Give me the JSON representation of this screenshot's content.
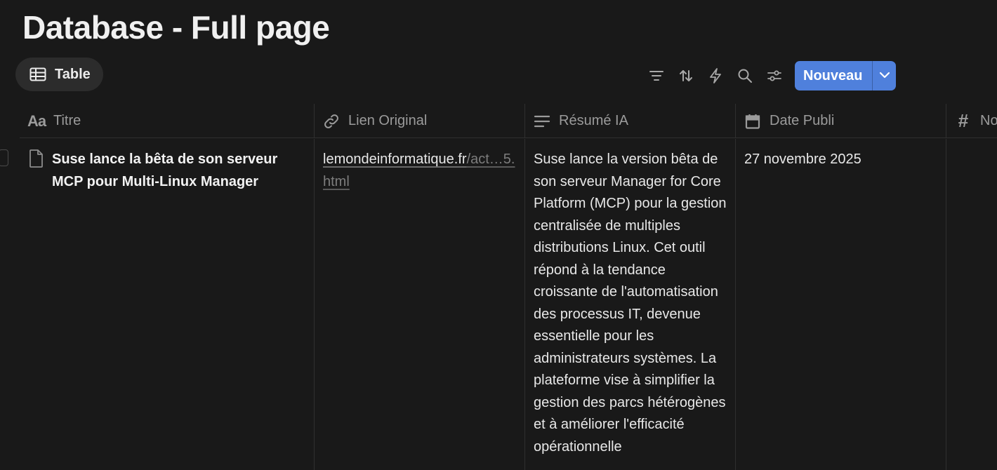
{
  "page": {
    "title": "Database - Full page"
  },
  "views": {
    "active_label": "Table"
  },
  "toolbar": {
    "icons": [
      "filter-icon",
      "sort-icon",
      "automation-icon",
      "search-icon",
      "settings-icon"
    ],
    "new_label": "Nouveau",
    "accent_color": "#4f80dc"
  },
  "table": {
    "columns": [
      {
        "label": "Titre",
        "icon": "title-icon"
      },
      {
        "label": "Lien Original",
        "icon": "link-icon"
      },
      {
        "label": "Résumé IA",
        "icon": "text-icon"
      },
      {
        "label": "Date Publi",
        "icon": "calendar-icon"
      },
      {
        "label": "No",
        "icon": "number-icon"
      }
    ],
    "rows": [
      {
        "title": "Suse lance la bêta de son serveur MCP pour Multi-Linux Manager",
        "link_domain": "lemondeinformatique.fr",
        "link_path": "/act…5.html",
        "summary": "Suse lance la version bêta de son serveur Manager for Core Platform (MCP) pour la gestion centralisée de multiples distributions Linux. Cet outil répond à la tendance croissante de l'automatisation des processus IT, devenue essentielle pour les administrateurs systèmes. La plateforme vise à simplifier la gestion des parcs hétérogènes et à améliorer l'efficacité opérationnelle",
        "date": "27 novembre 2025",
        "number": ""
      }
    ]
  }
}
